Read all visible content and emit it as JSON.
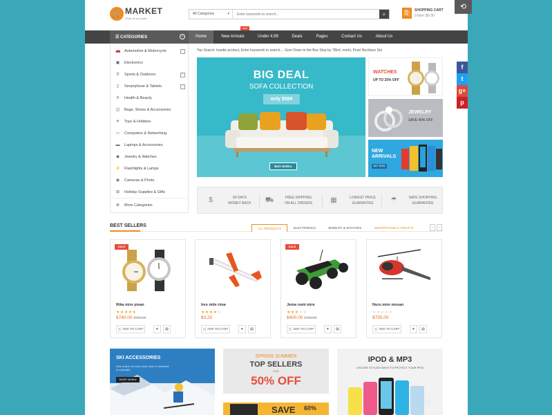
{
  "brand": {
    "name": "MARKET",
    "tagline": "Shop all you want"
  },
  "search": {
    "category": "All Categories",
    "placeholder": "Enter keywords to search..."
  },
  "cart": {
    "title": "SHOPPING CART",
    "summary": "0 item: $0.00"
  },
  "nav": {
    "categories_label": "CATEGORIES",
    "items": [
      "Home",
      "New Arrivals",
      "Under 4.99",
      "Deals",
      "Pages",
      "Contact Us",
      "About Us"
    ],
    "new_badge": "NEW"
  },
  "categories": [
    {
      "label": "Automotive & Motorcycle",
      "icon": "car-icon"
    },
    {
      "label": "Electronics",
      "icon": "tv-icon"
    },
    {
      "label": "Sports & Outdoors",
      "icon": "bike-icon"
    },
    {
      "label": "Smartphone & Tablets",
      "icon": "phone-icon"
    },
    {
      "label": "Health & Beauty",
      "icon": "bottle-icon"
    },
    {
      "label": "Bags, Shoes & Accessories",
      "icon": "bag-icon"
    },
    {
      "label": "Toys & Hobbies",
      "icon": "plane-icon"
    },
    {
      "label": "Computers & Networking",
      "icon": "monitor-icon"
    },
    {
      "label": "Laptops & Accessories",
      "icon": "laptop-icon"
    },
    {
      "label": "Jewelry & Watches",
      "icon": "diamond-icon"
    },
    {
      "label": "Flashlights & Lamps",
      "icon": "flashlight-icon"
    },
    {
      "label": "Cameras & Photo",
      "icon": "camera-icon"
    },
    {
      "label": "Holiday Supplies & Gifts",
      "icon": "gift-icon"
    },
    {
      "label": "More Categories",
      "icon": "plus-icon"
    }
  ],
  "top_search": "Top Search:  bundle product,  Enter keywords to search....  Goin Down to the Bus Stop by TBird,  morbi,  Pearl Necklace Set",
  "hero": {
    "title": "BIG DEAL",
    "subtitle": "SOFA COLLECTION",
    "price": "only $599",
    "button": "BUY NOW"
  },
  "side_banners": [
    {
      "title": "WATCHES",
      "sub": "UP TO 25% OFF"
    },
    {
      "title": "JEWELRY",
      "sub": "SAVE 40% OFF"
    },
    {
      "title": "NEW ARRIVALS",
      "sub": "BUY NOW"
    }
  ],
  "services": [
    {
      "line1": "90 DAYS",
      "line2": "MONEY BACK",
      "icon": "moneybag-icon"
    },
    {
      "line1": "FREE SHIPPING",
      "line2": "ON ALL ORDERS",
      "icon": "truck-icon"
    },
    {
      "line1": "LOWEST PRICE",
      "line2": "GUARANTEE",
      "icon": "calendar-icon"
    },
    {
      "line1": "SAFE SHOPPING",
      "line2": "GUARANTEE",
      "icon": "umbrella-icon"
    }
  ],
  "best_sellers": {
    "title": "BEST SELLERS",
    "tabs": [
      "ALL PRODUCTS",
      "ELECTRONICS",
      "JEWELRY & WATCHES",
      "SMARTPHONE & TABLETS"
    ],
    "products": [
      {
        "name": "Rika mire pisan",
        "price": "$740.00",
        "old_price": "$750.00",
        "rating": 5,
        "sale": "SALE"
      },
      {
        "name": "Ires mite rima",
        "price": "$3.25",
        "old_price": "",
        "rating": 4,
        "sale": ""
      },
      {
        "name": "Jema rumi mire",
        "price": "$400.00",
        "old_price": "$419.00",
        "rating": 3,
        "sale": "SALE"
      },
      {
        "name": "Nuru mire mosan",
        "price": "$755.00",
        "old_price": "",
        "rating": 0,
        "sale": ""
      }
    ],
    "add_to_cart": "ADD TO CART"
  },
  "promos": {
    "ski": {
      "title": "SKI ACCESSORIES",
      "text": "Duis autem vel eum iriure dolor in hendrerit in vulputate",
      "button": "SHOP NOW"
    },
    "spring": {
      "line1": "SPRING SUMMER",
      "line2": "TOP SELLERS",
      "flat": "FLAT",
      "off": "50% OFF"
    },
    "save": {
      "text": "SAVE",
      "pct": "60%"
    },
    "ipod": {
      "title": "IPOD & MP3",
      "sub": "CHOOSE STYLISH WAYS TO PROTECT YOUR IPOD"
    }
  },
  "social": [
    "f",
    "t",
    "g+",
    "p"
  ],
  "colors": {
    "accent": "#f08b1d",
    "nav": "#444444",
    "hero": "#36b9c9",
    "background": "#3aa8b8"
  }
}
